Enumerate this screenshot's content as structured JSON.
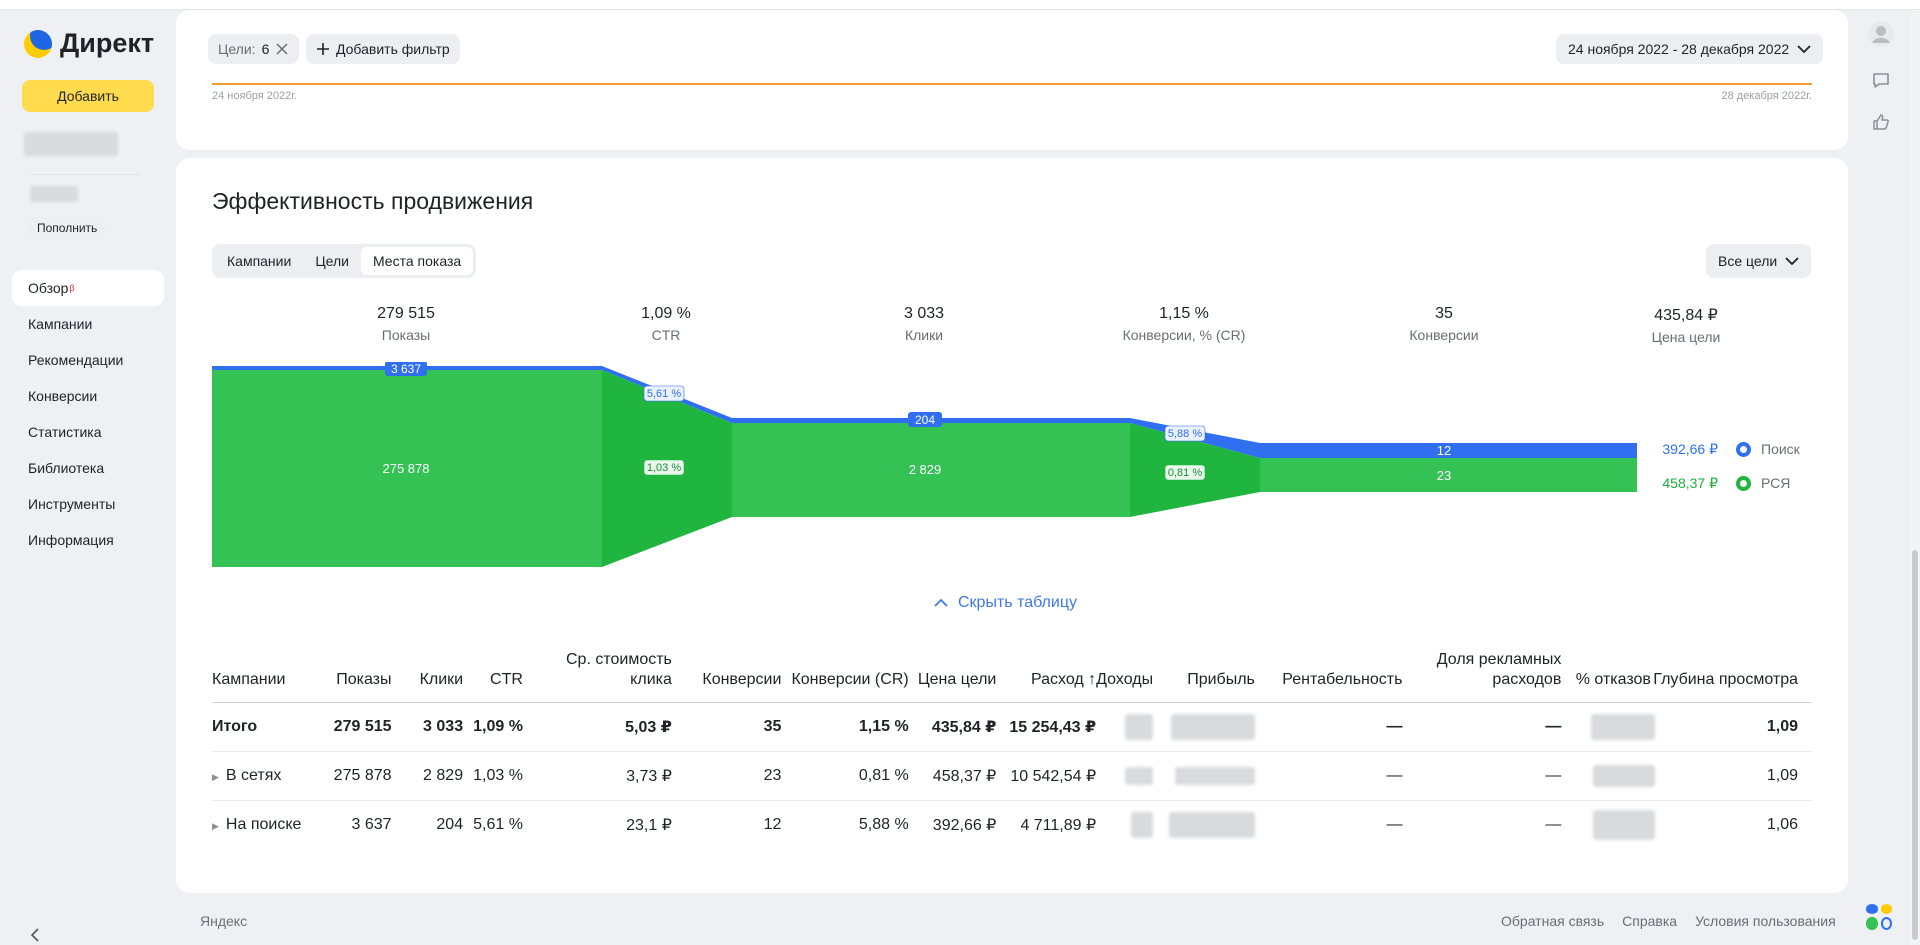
{
  "brand": {
    "name": "Директ",
    "add_label": "Добавить",
    "topup_label": "Пополнить"
  },
  "nav": [
    {
      "label": "Обзор",
      "badge": "β",
      "active": true
    },
    {
      "label": "Кампании"
    },
    {
      "label": "Рекомендации"
    },
    {
      "label": "Конверсии"
    },
    {
      "label": "Статистика"
    },
    {
      "label": "Библиотека"
    },
    {
      "label": "Инструменты"
    },
    {
      "label": "Информация"
    }
  ],
  "filters": {
    "goals_label": "Цели:",
    "goals_count": "6",
    "add_filter_label": "Добавить фильтр",
    "date_range": "24 ноября 2022 - 28 декабря 2022",
    "start_label": "24 ноября 2022г.",
    "end_label": "28 декабря 2022г."
  },
  "section": {
    "title": "Эффективность продвижения",
    "tabs": [
      "Кампании",
      "Цели",
      "Места показа"
    ],
    "active_tab": "Места показа",
    "goals_dropdown": "Все цели",
    "toggle_table": "Скрыть таблицу"
  },
  "metrics": [
    {
      "value": "279 515",
      "label": "Показы"
    },
    {
      "value": "1,09 %",
      "label": "CTR"
    },
    {
      "value": "3 033",
      "label": "Клики"
    },
    {
      "value": "1,15 %",
      "label": "Конверсии, % (CR)"
    },
    {
      "value": "35",
      "label": "Конверсии"
    },
    {
      "value": "435,84 ₽",
      "label": "Цена цели"
    }
  ],
  "funnel": {
    "search": {
      "name": "Поиск",
      "color": "#2f6ff0",
      "shows": "3 637",
      "ctr": "5,61 %",
      "clicks": "204",
      "cr": "5,88 %",
      "conversions": "12",
      "goal_price": "392,66 ₽"
    },
    "rsya": {
      "name": "РСЯ",
      "color": "#34c254",
      "shows": "275 878",
      "ctr": "1,03 %",
      "clicks": "2 829",
      "cr": "0,81 %",
      "conversions": "23",
      "goal_price": "458,37 ₽"
    }
  },
  "table": {
    "headers": [
      "Кампании",
      "Показы",
      "Клики",
      "CTR",
      "Ср. стоимость клика",
      "Конверсии",
      "Конверсии (CR)",
      "Цена цели",
      "Расход ↑",
      "Доходы",
      "Прибыль",
      "Рентабельность",
      "Доля рекламных расходов",
      "% отказов",
      "Глубина просмотра"
    ],
    "rows": [
      {
        "name": "Итого",
        "shows": "279 515",
        "clicks": "3 033",
        "ctr": "1,09 %",
        "cpc": "5,03 ₽",
        "conv": "35",
        "cr": "1,15 %",
        "price": "435,84 ₽",
        "spend": "15 254,43 ₽",
        "roi": "—",
        "share": "—",
        "depth": "1,09"
      },
      {
        "name": "В сетях",
        "shows": "275 878",
        "clicks": "2 829",
        "ctr": "1,03 %",
        "cpc": "3,73 ₽",
        "conv": "23",
        "cr": "0,81 %",
        "price": "458,37 ₽",
        "spend": "10 542,54 ₽",
        "roi": "—",
        "share": "—",
        "depth": "1,09"
      },
      {
        "name": "На поиске",
        "shows": "3 637",
        "clicks": "204",
        "ctr": "5,61 %",
        "cpc": "23,1 ₽",
        "conv": "12",
        "cr": "5,88 %",
        "price": "392,66 ₽",
        "spend": "4 711,89 ₽",
        "roi": "—",
        "share": "—",
        "depth": "1,06"
      }
    ]
  },
  "footer": {
    "left": "Яндекс",
    "links": [
      "Обратная связь",
      "Справка",
      "Условия пользования"
    ]
  },
  "icons": [
    "user-avatar-icon",
    "chat-icon",
    "thumb-up-icon",
    "close-icon",
    "plus-icon",
    "chevron-down-icon",
    "chevron-up-icon",
    "chevron-left-icon",
    "apps-grid-icon"
  ]
}
